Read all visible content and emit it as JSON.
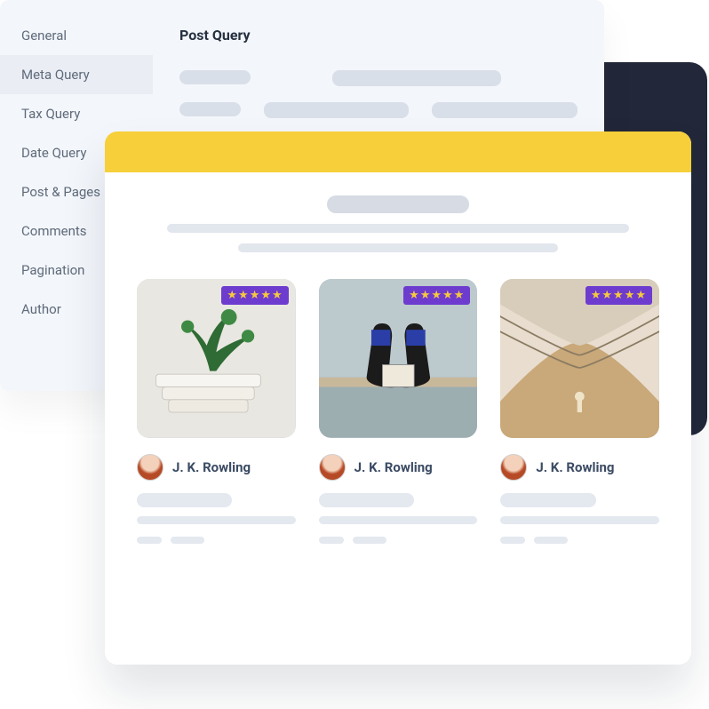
{
  "sidebar": {
    "items": [
      {
        "label": "General"
      },
      {
        "label": "Meta Query"
      },
      {
        "label": "Tax Query"
      },
      {
        "label": "Date Query"
      },
      {
        "label": "Post & Pages"
      },
      {
        "label": "Comments"
      },
      {
        "label": "Pagination"
      },
      {
        "label": "Author"
      }
    ],
    "active_index": 1
  },
  "panel": {
    "title": "Post Query"
  },
  "front": {
    "accent_color": "#f6cf3a",
    "rating_bg": "#6d3ccf",
    "rating_star_color": "#f7c93c",
    "cards": [
      {
        "rating_stars": "★★★★★",
        "author": "J. K. Rowling"
      },
      {
        "rating_stars": "★★★★★",
        "author": "J. K. Rowling"
      },
      {
        "rating_stars": "★★★★★",
        "author": "J. K. Rowling"
      }
    ]
  }
}
